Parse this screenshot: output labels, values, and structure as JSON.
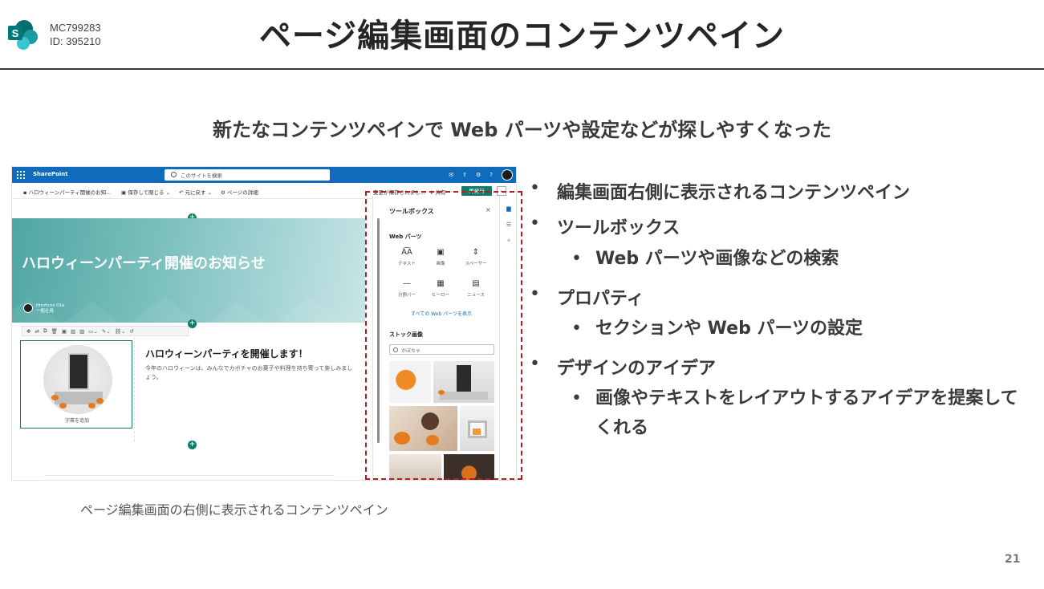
{
  "header": {
    "mc_code": "MC799283",
    "id_label": "ID: 395210",
    "title": "ページ編集画面のコンテンツペイン"
  },
  "subtitle": "新たなコンテンツペインで Web パーツや設定などが探しやすくなった",
  "screenshot": {
    "suitebar": {
      "app_name": "SharePoint",
      "search_placeholder": "このサイトを検索",
      "icons": [
        "chat-icon",
        "share-icon",
        "settings-icon",
        "help-icon"
      ],
      "help_glyph": "?"
    },
    "commandbar": {
      "page_name": "ハロウィーンパーティ開催のお知...",
      "save_close": "保存して閉じる",
      "undo": "元に戻す",
      "page_details": "ページの詳細",
      "status": "変更が保存されまし...",
      "share": "共有",
      "publish": "再発行"
    },
    "hero": {
      "title": "ハロウィーンパーティ開催のお知らせ",
      "author_name": "Hirofumi Ota",
      "author_role": "一般社員"
    },
    "image_caption": "字幕を追加",
    "article": {
      "title": "ハロウィーンパーティを開催します！",
      "body": "今年のハロウィーンは、みんなでカボチャのお菓子や料理を持ち寄って楽しみましょう。"
    },
    "toolbox": {
      "title": "ツールボックス",
      "close": "×",
      "webparts_heading": "Web パーツ",
      "webparts": [
        {
          "label": "テキスト",
          "glyph": "A͡A"
        },
        {
          "label": "画像",
          "glyph": "▣"
        },
        {
          "label": "スペーサー",
          "glyph": "⇕"
        },
        {
          "label": "分割バー",
          "glyph": "—"
        },
        {
          "label": "ヒーロー",
          "glyph": "▦"
        },
        {
          "label": "ニュース",
          "glyph": "▤"
        }
      ],
      "all_webparts_link": "すべての Web パーツを表示",
      "stock_heading": "ストック画像",
      "stock_search": "かぼちゃ"
    }
  },
  "screenshot_caption": "ページ編集画面の右側に表示されるコンテンツペイン",
  "bullets": [
    {
      "level": 1,
      "text": "編集画面右側に表示されるコンテンツペイン"
    },
    {
      "level": 1,
      "text": "ツールボックス"
    },
    {
      "level": 2,
      "text": "Web パーツや画像などの検索"
    },
    {
      "level": 1,
      "text": "プロパティ"
    },
    {
      "level": 2,
      "text": "セクションや Web パーツの設定"
    },
    {
      "level": 1,
      "text": "デザインのアイデア"
    },
    {
      "level": 2,
      "text": "画像やテキストをレイアウトするアイデアを提案してくれる"
    }
  ],
  "bullet_glyph": "•",
  "page_number": "21",
  "colors": {
    "suitebar": "#0f6cbd",
    "accent_teal": "#0f7b6c",
    "highlight_frame": "#b21f1f",
    "text_dark": "#3a3a3a"
  }
}
